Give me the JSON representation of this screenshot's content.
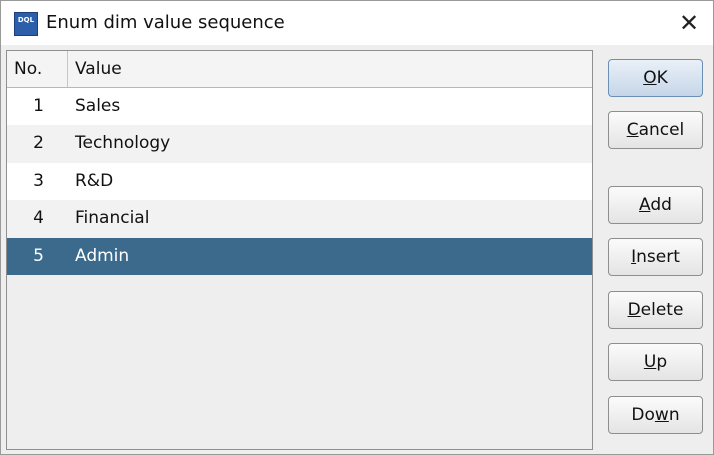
{
  "window": {
    "title": "Enum dim value sequence",
    "icon_text": "DQL",
    "close_glyph": "✕"
  },
  "table": {
    "columns": [
      "No.",
      "Value"
    ],
    "rows": [
      {
        "no": "1",
        "value": "Sales",
        "selected": false
      },
      {
        "no": "2",
        "value": "Technology",
        "selected": false
      },
      {
        "no": "3",
        "value": "R&D",
        "selected": false
      },
      {
        "no": "4",
        "value": "Financial",
        "selected": false
      },
      {
        "no": "5",
        "value": "Admin",
        "selected": true
      }
    ]
  },
  "buttons": {
    "ok": {
      "pre": "",
      "mn": "O",
      "post": "K"
    },
    "cancel": {
      "pre": "",
      "mn": "C",
      "post": "ancel"
    },
    "add": {
      "pre": "",
      "mn": "A",
      "post": "dd"
    },
    "insert": {
      "pre": "",
      "mn": "I",
      "post": "nsert"
    },
    "delete": {
      "pre": "",
      "mn": "D",
      "post": "elete"
    },
    "up": {
      "pre": "",
      "mn": "U",
      "post": "p"
    },
    "down": {
      "pre": "Do",
      "mn": "w",
      "post": "n"
    }
  },
  "colors": {
    "selection": "#3b6a8c",
    "panel": "#eeeeee",
    "default_button": "#c6d6e8"
  }
}
